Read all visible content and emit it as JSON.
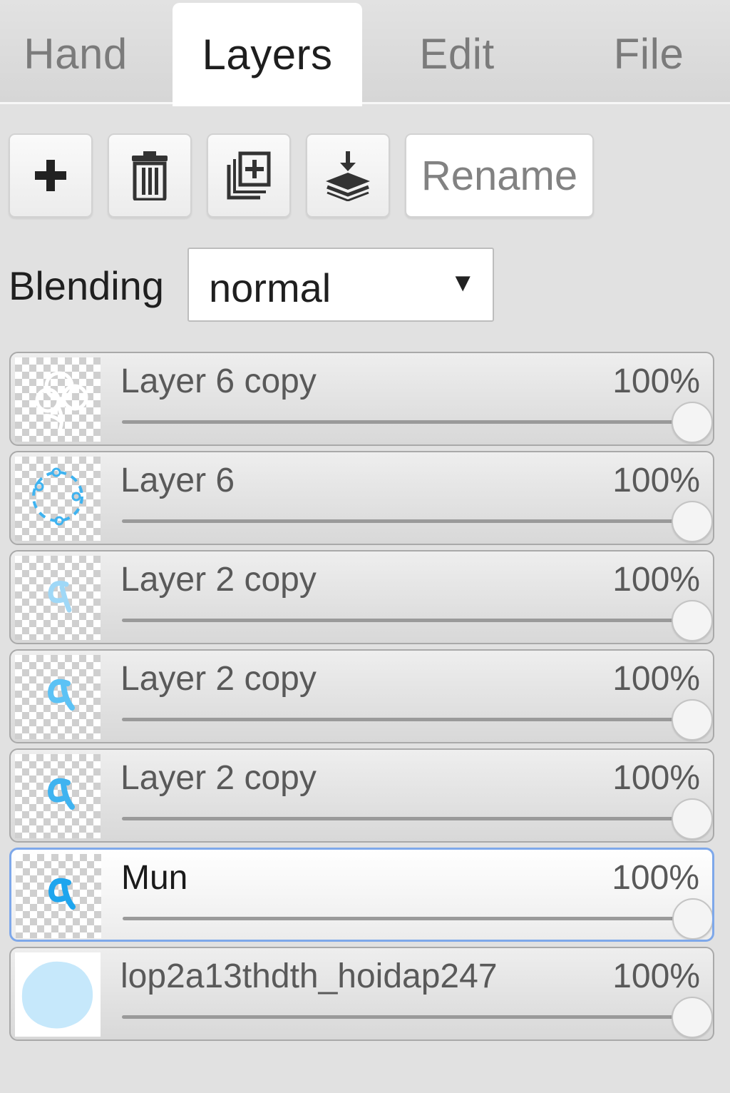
{
  "tabs": [
    {
      "label": "Hand",
      "active": false
    },
    {
      "label": "Layers",
      "active": true
    },
    {
      "label": "Edit",
      "active": false
    },
    {
      "label": "File",
      "active": false
    }
  ],
  "toolbar": {
    "add_icon": "plus-icon",
    "delete_icon": "trash-icon",
    "duplicate_icon": "duplicate-icon",
    "merge_icon": "merge-down-icon",
    "rename_label": "Rename"
  },
  "blending": {
    "label": "Blending",
    "value": "normal",
    "caret": "▼"
  },
  "layers": [
    {
      "name": "Layer 6 copy",
      "opacity": "100%",
      "opacity_value": 1.0,
      "selected": false,
      "thumb": "white-flower"
    },
    {
      "name": "Layer 6",
      "opacity": "100%",
      "opacity_value": 1.0,
      "selected": false,
      "thumb": "blue-dotted-ring"
    },
    {
      "name": "Layer 2 copy",
      "opacity": "100%",
      "opacity_value": 1.0,
      "selected": false,
      "thumb": "pale-blue-glyph"
    },
    {
      "name": "Layer 2 copy",
      "opacity": "100%",
      "opacity_value": 1.0,
      "selected": false,
      "thumb": "blue-glyph"
    },
    {
      "name": "Layer 2 copy",
      "opacity": "100%",
      "opacity_value": 1.0,
      "selected": false,
      "thumb": "blue-glyph"
    },
    {
      "name": "Mun",
      "opacity": "100%",
      "opacity_value": 1.0,
      "selected": true,
      "thumb": "blue-glyph"
    },
    {
      "name": "lop2a13thdth_hoidap247",
      "opacity": "100%",
      "opacity_value": 1.0,
      "selected": false,
      "thumb": "light-blue-blob"
    }
  ],
  "colors": {
    "background": "#e1e1e1",
    "selected_border": "#7ea8ea",
    "thumb_blue": "#3fb3f0",
    "thumb_light_blue": "#c6e8fb"
  }
}
